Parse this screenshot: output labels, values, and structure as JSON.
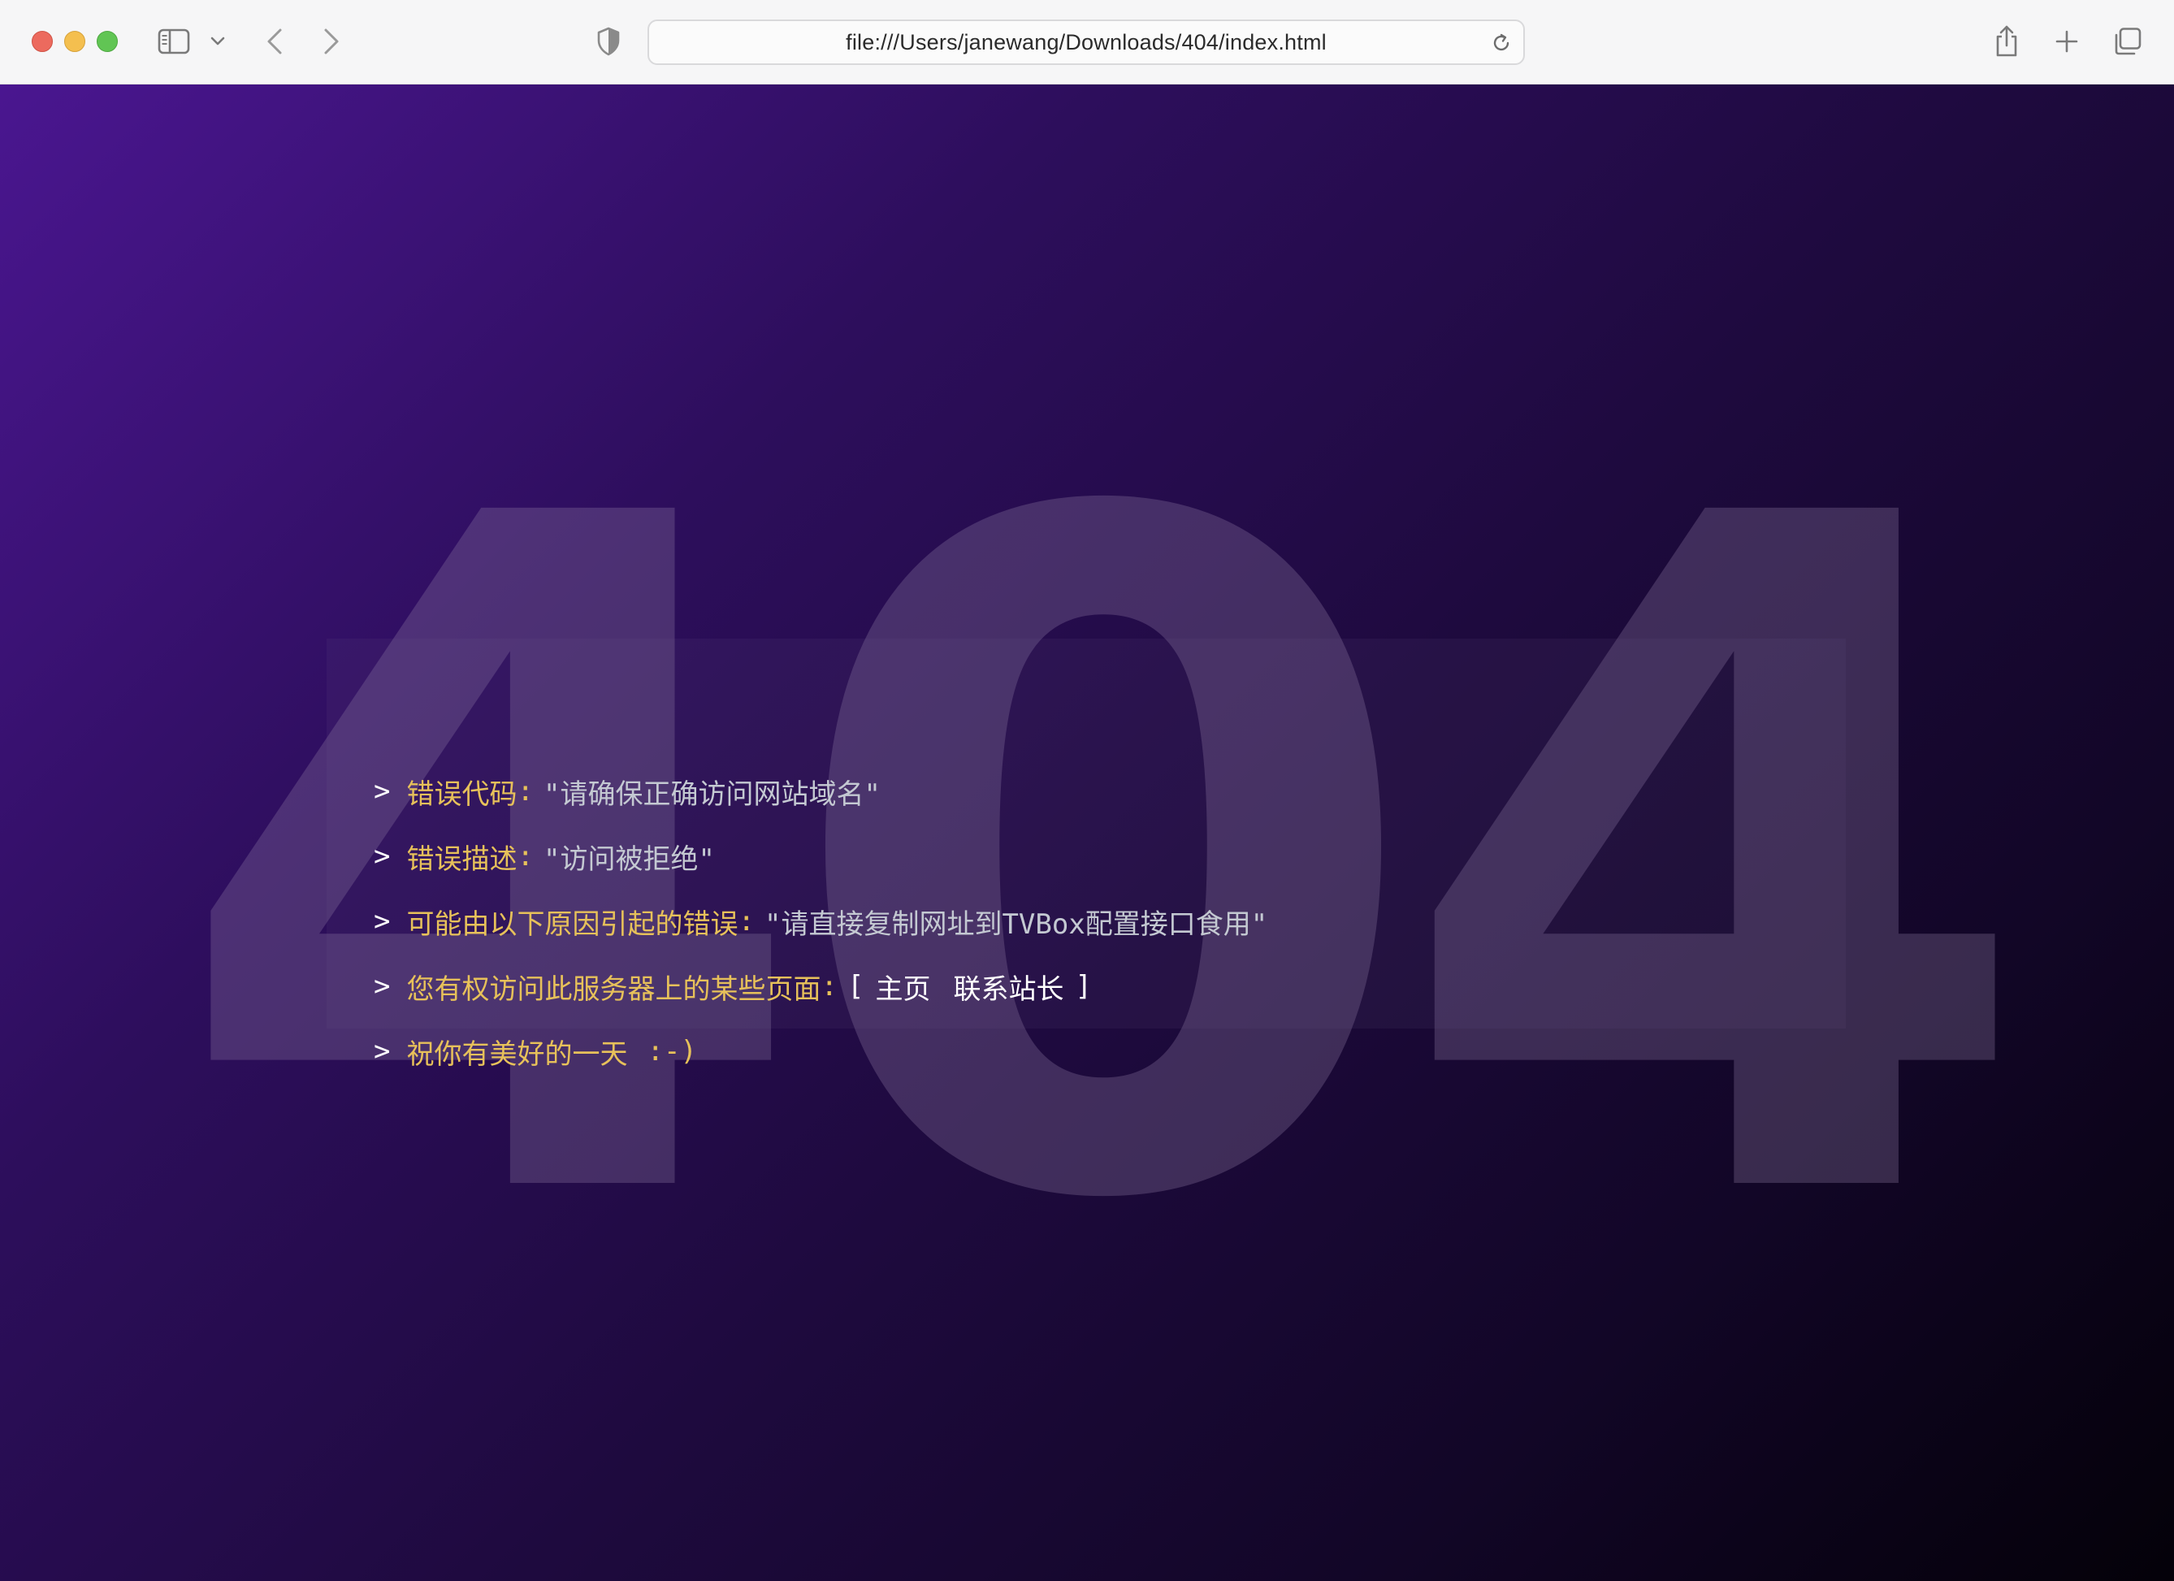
{
  "browser": {
    "url": "file:///Users/janewang/Downloads/404/index.html"
  },
  "page": {
    "big_code": "404",
    "lines": [
      {
        "prompt": ">",
        "key": "错误代码",
        "colon": ":",
        "value": "\"请确保正确访问网站域名\""
      },
      {
        "prompt": ">",
        "key": "错误描述",
        "colon": ":",
        "value": "\"访问被拒绝\""
      },
      {
        "prompt": ">",
        "key": "可能由以下原因引起的错误",
        "colon": ":",
        "value": "\"请直接复制网址到TVBox配置接口食用\""
      },
      {
        "prompt": ">",
        "key": "您有权访问此服务器上的某些页面",
        "colon": ":",
        "bracket_open": "[",
        "bracket_close": "]",
        "links": [
          "主页",
          "联系站长"
        ]
      },
      {
        "prompt": ">",
        "key": "祝你有美好的一天",
        "smile": ":-)"
      }
    ]
  },
  "colors": {
    "key": "#e7c15a",
    "value": "#c4c9d2",
    "gradient_start": "#4a1690",
    "gradient_end": "#040109"
  }
}
